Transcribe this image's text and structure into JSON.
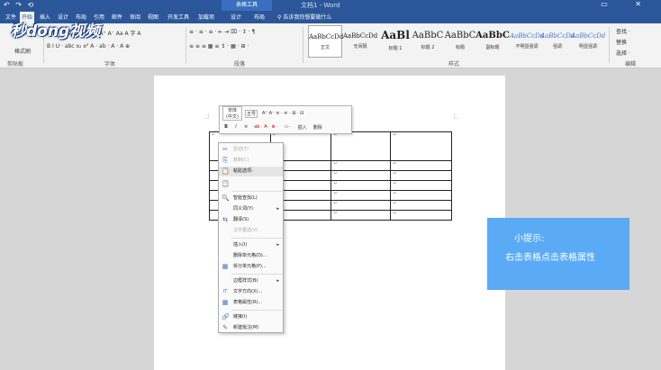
{
  "window": {
    "qat": "↶ ↷ ⟲",
    "context_tab": "表格工具",
    "doc_title": "文档1 - Word",
    "controls": "▭ ✕"
  },
  "tabs": [
    {
      "label": "文件"
    },
    {
      "label": "开始"
    },
    {
      "label": "插入"
    },
    {
      "label": "设计"
    },
    {
      "label": "布局"
    },
    {
      "label": "引用"
    },
    {
      "label": "邮件"
    },
    {
      "label": "审阅"
    },
    {
      "label": "视图"
    },
    {
      "label": "开发工具"
    },
    {
      "label": "加载项"
    },
    {
      "label": "设计"
    },
    {
      "label": "布局"
    }
  ],
  "tell_me": "告诉我你想要做什么",
  "logo": "秒dong视频",
  "ribbon": {
    "clipboard_label": "剪贴板",
    "font_label": "字体",
    "paragraph_label": "段落",
    "styles_label": "样式",
    "editing_label": "编辑",
    "format_painter": "格式刷",
    "font_row1": "宋体 (中文正文)  五号  A⁺ A⁻ Aa A 字 A",
    "font_row2": "B I U · abc x₂ x² A · ab · A · A ⊕",
    "para_row1": "≡ · ≡ · ≡ ·  ⇤ ⇥  ⌧ · ↕ ·  ¶",
    "para_row2": "≡ ≡ ≡ ▦ ≡  ↕ ·  ▦ · ⊞ ·",
    "find": "查找 ·",
    "replace": "替换",
    "select": "选择 ·",
    "styles": [
      {
        "sample": "AaBbCcDd",
        "name": "正文"
      },
      {
        "sample": "AaBbCcDd",
        "name": "无间隔"
      },
      {
        "sample": "AaBl",
        "name": "标题 1"
      },
      {
        "sample": "AaBbC",
        "name": "标题 2"
      },
      {
        "sample": "AaBbC",
        "name": "标题"
      },
      {
        "sample": "AaBbC",
        "name": "副标题"
      },
      {
        "sample": "AaBbCcDd",
        "name": "不明显强调"
      },
      {
        "sample": "AaBbCcDd",
        "name": "强调"
      },
      {
        "sample": "AaBbCcDd",
        "name": "明显强调"
      }
    ]
  },
  "mini_toolbar": {
    "font": "宋体 (中文)",
    "size": "五号",
    "row1_tail": "A⁺ A⁻ ≡ · ≡ · ⊞ · ⊟",
    "row2_a": "B",
    "row2_b": "I",
    "row2_c": "≡",
    "row2_d": "ab · A · ⊕ ·",
    "row2_e": "▭ ·",
    "insert": "插入",
    "delete": "删除"
  },
  "context_menu": [
    {
      "label": "剪切(T)",
      "icon": "✂",
      "disabled": true
    },
    {
      "label": "复制(C)",
      "icon": "⎘",
      "disabled": true
    },
    {
      "label": "粘贴选项:",
      "icon": "📋",
      "disabled": false,
      "highlight": true
    },
    {
      "label": "",
      "icon": "📋",
      "disabled": false
    },
    {
      "label": "智能查找(L)",
      "icon": "🔍",
      "disabled": false
    },
    {
      "label": "同义词(Y)",
      "icon": "",
      "disabled": false,
      "submenu": true
    },
    {
      "label": "翻译(S)",
      "icon": "⇆",
      "disabled": false
    },
    {
      "label": "汉字重选(V)",
      "icon": "",
      "disabled": true
    },
    {
      "label": "插入(I)",
      "icon": "",
      "disabled": false,
      "submenu": true
    },
    {
      "label": "删除单元格(D)...",
      "icon": "",
      "disabled": false
    },
    {
      "label": "拆分单元格(P)...",
      "icon": "▦",
      "disabled": false
    },
    {
      "label": "边框样式(B)",
      "icon": "",
      "disabled": false,
      "submenu": true
    },
    {
      "label": "文字方向(X)...",
      "icon": "IT",
      "disabled": false
    },
    {
      "label": "表格属性(R)...",
      "icon": "▦",
      "disabled": false
    },
    {
      "label": "链接(I)",
      "icon": "🔗",
      "disabled": false
    },
    {
      "label": "新建批注(M)",
      "icon": "✎",
      "disabled": false
    }
  ],
  "tip": {
    "title": "小提示:",
    "body": "右击表格点击表格属性"
  },
  "colors": {
    "ribbon_blue": "#2b579a",
    "tip_blue": "#5aaaf5"
  }
}
